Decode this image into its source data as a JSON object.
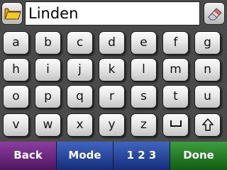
{
  "input": {
    "value": "Linden"
  },
  "icons": {
    "folder": "folder-icon",
    "eraser": "eraser-icon",
    "space": "space-icon",
    "shift": "shift-arrow-icon"
  },
  "keyboard": {
    "row1": [
      "a",
      "b",
      "c",
      "d",
      "e",
      "f",
      "g"
    ],
    "row2": [
      "h",
      "i",
      "j",
      "k",
      "l",
      "m",
      "n"
    ],
    "row3": [
      "o",
      "p",
      "q",
      "r",
      "s",
      "t",
      "u"
    ],
    "row4": [
      "v",
      "w",
      "x",
      "y",
      "z"
    ]
  },
  "softkeys": {
    "back": "Back",
    "mode": "Mode",
    "numbers": "1 2 3",
    "done": "Done"
  },
  "colors": {
    "back": "#6a2880",
    "mode": "#243f9c",
    "numbers": "#243f9c",
    "done": "#1f7a20"
  }
}
